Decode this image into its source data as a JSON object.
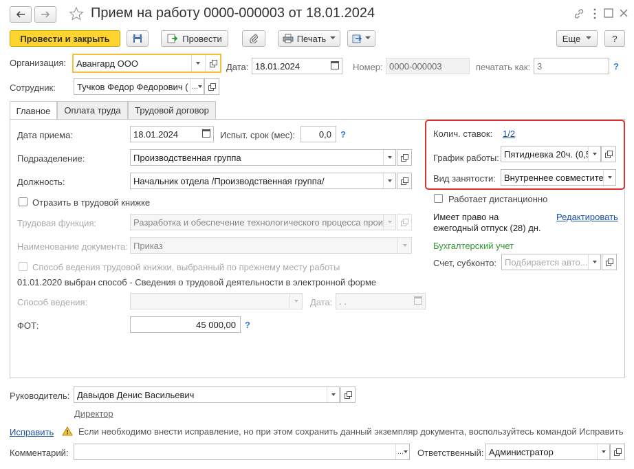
{
  "title": "Прием на работу 0000-000003 от 18.01.2024",
  "toolbar": {
    "post_close": "Провести и закрыть",
    "post": "Провести",
    "print": "Печать",
    "more": "Еще",
    "help": "?"
  },
  "header": {
    "org_label": "Организация:",
    "org_value": "Авангард ООО",
    "date_label": "Дата:",
    "date_value": "18.01.2024",
    "number_label": "Номер:",
    "number_value": "0000-000003",
    "print_as_label": "печатать как:",
    "print_as_placeholder": "3",
    "employee_label": "Сотрудник:",
    "employee_value": "Тучков Федор Федорович ("
  },
  "tabs": [
    "Главное",
    "Оплата труда",
    "Трудовой договор"
  ],
  "main": {
    "hire_date_label": "Дата приема:",
    "hire_date_value": "18.01.2024",
    "probation_label": "Испыт. срок (мес):",
    "probation_value": "0,0",
    "department_label": "Подразделение:",
    "department_value": "Производственная группа",
    "position_label": "Должность:",
    "position_value": "Начальник отдела /Производственная группа/",
    "workbook_checkbox": "Отразить в трудовой книжке",
    "labor_function_label": "Трудовая функция:",
    "labor_function_value": "Разработка и обеспечение технологического процесса прои",
    "doc_name_label": "Наименование документа:",
    "doc_name_value": "Приказ",
    "prev_method_checkbox": "Способ ведения трудовой книжки, выбранный по прежнему месту работы",
    "method_note": "01.01.2020 выбран способ - Сведения о трудовой деятельности в электронной форме",
    "method_label": "Способ ведения:",
    "method_date_label": "Дата:",
    "method_date_value": " .  .",
    "fot_label": "ФОТ:",
    "fot_value": "45 000,00"
  },
  "right": {
    "rates_label": "Колич. ставок:",
    "rates_value": "1/2",
    "schedule_label": "График работы:",
    "schedule_value": "Пятидневка 20ч. (0,5",
    "employment_label": "Вид занятости:",
    "employment_value": "Внутреннее совместите",
    "remote_checkbox": "Работает дистанционно",
    "vacation_text": "Имеет право на ежегодный отпуск (28) дн.",
    "edit_link": "Редактировать",
    "accounting_label": "Бухгалтерский учет",
    "account_label": "Счет, субконто:",
    "account_placeholder": "Подбирается авто..."
  },
  "footer": {
    "manager_label": "Руководитель:",
    "manager_value": "Давыдов Денис Васильевич",
    "manager_position": "Директор",
    "fix_link": "Исправить",
    "warning_text": "Если необходимо внести исправление, но при этом сохранить данный экземпляр документа, воспользуйтесь командой Исправить",
    "comment_label": "Комментарий:",
    "responsible_label": "Ответственный:",
    "responsible_value": "Администратор"
  },
  "colors": {
    "accent": "#ffd42f",
    "highlight": "#d9322b",
    "link": "#1a4fa6",
    "green": "#2f9a2f"
  }
}
